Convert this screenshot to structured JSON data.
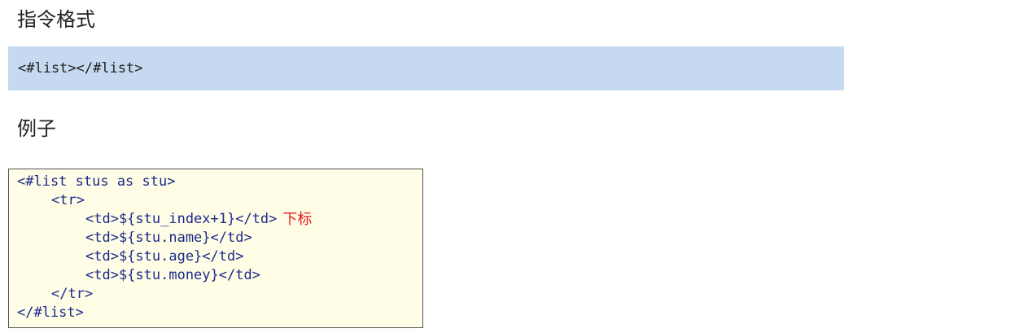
{
  "headings": {
    "format": "指令格式",
    "example": "例子"
  },
  "format_code": "<#list></#list>",
  "example_code": {
    "lines": [
      "<#list stus as stu>",
      "<tr>",
      "<td>${stu_index+1}</td>",
      "<td>${stu.name}</td>",
      "<td>${stu.age}</td>",
      "<td>${stu.money}</td>",
      "</tr>",
      "</#list>"
    ],
    "annotation": "下标"
  },
  "colors": {
    "format_box_bg": "#c5d9f1",
    "code_box_bg": "#fffde5",
    "code_text": "#1a2a8c",
    "annotation_text": "#e02020"
  }
}
